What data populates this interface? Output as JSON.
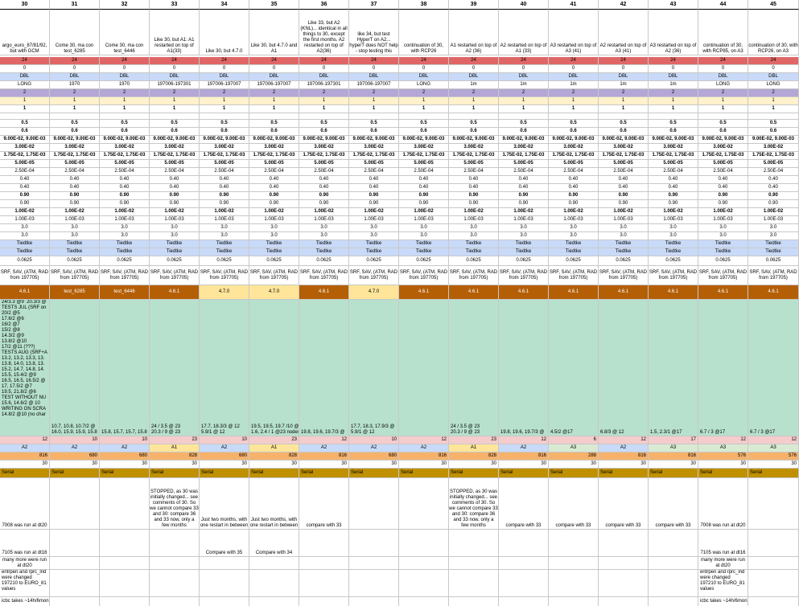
{
  "sheet": {
    "columns": [
      "30",
      "31",
      "32",
      "33",
      "34",
      "35",
      "36",
      "37",
      "38",
      "39",
      "40",
      "41",
      "42",
      "43",
      "44",
      "45"
    ],
    "descriptions": [
      "argo_euro_87/81/92, but with GCM",
      "Come 30, ma con test_6285",
      "Come 30, ma con test_6446",
      "Like 30, but A1: A1 restarted on top of A1(33)",
      "Like 30, but 4.7.0",
      "Like 30, but 4.7.0 and A1",
      "Like 33, but A2 (KNL)... identical in all things to 30, except the first months. A2 restarted on top of A2(36)",
      "like 34, but test HyperT on A2... hyperT does NOT help - stop testing this",
      "continuation of 30, with RCP26",
      "A1 restarted on top of A2 (36)",
      "A2 restarted on top of A1 (33)",
      "A3 restarted on top of A3 (41)",
      "A2 restarted on top of A3 (41)",
      "A3 restarted on top of A2 (36)",
      "continuation of 30, with RCP85, on A3",
      "continuation of 30, with RCP26, on A3"
    ],
    "r24": [
      "24",
      "24",
      "24",
      "24",
      "24",
      "24",
      "24",
      "24",
      "24",
      "24",
      "24",
      "24",
      "24",
      "24",
      "24",
      "24"
    ],
    "r0": [
      "0",
      "0",
      "0",
      "0",
      "0",
      "0",
      "0",
      "0",
      "0",
      "0",
      "0",
      "0",
      "0",
      "0",
      "0",
      "0"
    ],
    "dbl": [
      "DBL",
      "DBL",
      "DBL",
      "DBL",
      "DBL",
      "DBL",
      "DBL",
      "DBL",
      "DBL",
      "DBL",
      "DBL",
      "DBL",
      "DBL",
      "DBL",
      "DBL",
      "DBL"
    ],
    "run": [
      "LONG",
      "1970",
      "1970",
      "197006-197301",
      "197006-197007",
      "197006-197007",
      "197006-197301",
      "197006-197007",
      "LONG",
      "1m",
      "1m",
      "1m",
      "1m",
      "1m",
      "LONG",
      "LONG"
    ],
    "r2": [
      "2",
      "2",
      "2",
      "2",
      "2",
      "2",
      "2",
      "2",
      "2",
      "2",
      "2",
      "2",
      "2",
      "2",
      "2",
      "2"
    ],
    "r1a": [
      "1",
      "1",
      "1",
      "1",
      "1",
      "1",
      "1",
      "1",
      "1",
      "1",
      "1",
      "1",
      "1",
      "1",
      "1",
      "1"
    ],
    "r1b": [
      "1",
      "1",
      "1",
      "1",
      "1",
      "1",
      "1",
      "1",
      "1",
      "1",
      "1",
      "1",
      "1",
      "1",
      "1",
      "1"
    ],
    "v05": "0.5",
    "v06": "0.6",
    "v9e": "9.00E-02, 9.00E-03",
    "v3e": "3.00E-02",
    "v175": "1.75E-02, 1.75E-03",
    "v5e": "5.00E-05",
    "v25e": "2.50E-04",
    "v040a": "0.40",
    "v040b": "0.40",
    "v090a": "0.90",
    "v090b": "0.90",
    "v1e2": "1.00E-02",
    "v1e3": "1.00E-03",
    "v30a": "3.0",
    "v30b": "3.0",
    "tied1": "Tiedtke",
    "tied2": "Tiedtke",
    "v0625": "0.0625",
    "srf": "SRF, SAV, (ATM, RAD from 197705)",
    "version": [
      "4.6.1",
      "test_6285",
      "test_6446",
      "4.6.1",
      "4.7.0",
      "4.7.0",
      "4.6.1",
      "4.7.0",
      "4.6.1",
      "4.6.1",
      "4.6.1",
      "4.6.1",
      "4.6.1",
      "4.6.1",
      "4.6.1",
      "4.6.1"
    ],
    "perf": [
      "24/3.3 @9  20.3/3 @\nTESTS JUL (SRF on\n20/2 @5\n17.6/2 @6\n16/2 @7\n15/2 @8\n14.3/2 @9\n13.8/2 @10\n17/2 @11 (???)\nTESTS AUG (SRF+A\n13.2, 13.2, 13.3, 13.\n13.8, 14.0, 13.8, 13.\n15.2, 14.7, 14.8, 14.\n15.5, 15.4/2 @9\n16.5, 16.5, 16.5/2 @\n17, 17.5/2 @7\n19.5, 21.8/2 @6\nTEST WITHOUT NU\n15.6, 14.6/2 @ 10\nWRITING ON SCRA\n14.8/2 @10 (no char",
      "10.7, 10.8, 10.7/2 @\n16.0, 15.9, 15.9, 15.8",
      "15.8, 15.7, 15.7, 15.8",
      "24 / 3.5 @ 23\n20.3 / 9 @ 23",
      "17.7, 18.3/3 @ 12\n5.9/1 @ 12",
      "19.5, 19.5, 19.7 /10 @\n1.6, 2.4 / 1 @23 nodes",
      "19.8, 19.6, 19.7/3 @",
      "17.7, 18.3, 17.9/3 @\n5.9/1 @ 12",
      "",
      "24 / 3.5 @ 23\n20.3 / 9 @ 23",
      "19.8, 19.6, 19.7/3 @",
      "4.5/2 @17",
      "6.8/3 @ 12",
      "1.5, 2.3/1 @17",
      "6.7 / 3 @17",
      "6.7 / 3 @17"
    ],
    "nodes": [
      "12",
      "10",
      "10",
      "23",
      "10",
      "23",
      "12",
      "10",
      "12",
      "23",
      "12",
      "6",
      "12",
      "17",
      "12",
      "12"
    ],
    "arch": [
      "A2",
      "A2",
      "A2",
      "A1",
      "A2",
      "A1",
      "A2",
      "A2",
      "A2",
      "A1",
      "A2",
      "A3",
      "A2",
      "A3",
      "A3",
      "A3"
    ],
    "procs": [
      "816",
      "680",
      "680",
      "828",
      "680",
      "828",
      "816",
      "680",
      "816",
      "828",
      "816",
      "288",
      "816",
      "816",
      "576",
      "576"
    ],
    "days": [
      "30",
      "30",
      "30",
      "30",
      "30",
      "30",
      "30",
      "30",
      "30",
      "30",
      "30",
      "30",
      "30",
      "30",
      "30",
      "30"
    ],
    "serial": "Serial",
    "notes1": [
      "7008 was run at dt20",
      "",
      "",
      "STOPPED, as 30 was initially changed... see comments of 30. So we cannot compare 33 and 30: compare 36 and 33 now, only a few months",
      "Just two months, with one restart in between",
      "Just two months, with one restart in between",
      "compare with 33",
      "",
      "",
      "STOPPED, as 30 was initially changed... see comments of 30. So we cannot compare 33 and 30: compare 36 and 33 now, only a few months",
      "compare with 33",
      "compare with 33",
      "compare with 33",
      "compare with 33",
      "7008 was run at dt20",
      ""
    ],
    "notes2": [
      "7105 was run at dt16",
      "",
      "",
      "",
      "Compare with 35",
      "Compare with 34",
      "",
      "",
      "",
      "",
      "",
      "",
      "",
      "",
      "7105 was run at dt16",
      ""
    ],
    "notes3": [
      "many more were run at dt20",
      "",
      "",
      "",
      "",
      "",
      "",
      "",
      "",
      "",
      "",
      "",
      "",
      "",
      "many more were run at dt20",
      ""
    ],
    "notes4": [
      "entrpen and rprc_lnd were changed 197210 to EURO_81 values",
      "",
      "",
      "",
      "",
      "",
      "",
      "",
      "",
      "",
      "",
      "",
      "",
      "",
      "entrpen and rprc_lnd were changed 197210 to EURO_81 values",
      ""
    ],
    "notes5": [
      "icbc takes ~14h/6mon",
      "",
      "",
      "",
      "",
      "",
      "",
      "",
      "",
      "",
      "",
      "",
      "",
      "",
      "icbc takes ~14h/6mon",
      ""
    ],
    "colors": {
      "red": "#e06666",
      "blue": "#c9daf8",
      "purple": "#b4a7d6",
      "lightyellow": "#fff2cc",
      "orange": "#b45f06",
      "yellow": "#ffe599",
      "green": "#b7e1cd",
      "pink": "#f4cccc",
      "peach": "#f6b26b",
      "lightgreen": "#d9ead3",
      "darkyellow": "#bf9000"
    }
  }
}
